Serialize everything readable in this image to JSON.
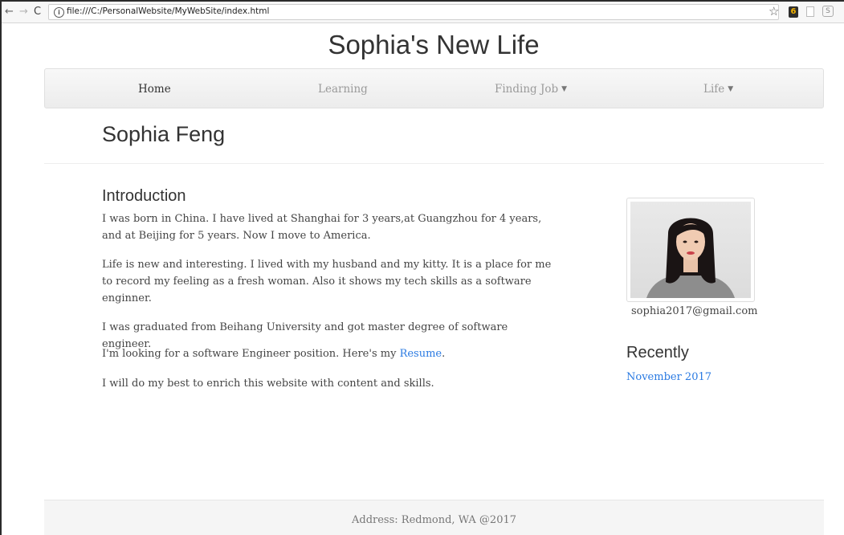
{
  "browser": {
    "back": "←",
    "forward": "→",
    "reload": "C",
    "info": "i",
    "url": "file:///C:/PersonalWebsite/MyWebSite/index.html",
    "star": "☆",
    "ext1": "6",
    "ext3": "S"
  },
  "site": {
    "title": "Sophia's New Life"
  },
  "nav": {
    "items": [
      {
        "label": "Home",
        "active": true
      },
      {
        "label": "Learning"
      },
      {
        "label": "Finding Job",
        "dropdown": true
      },
      {
        "label": "Life",
        "dropdown": true
      }
    ],
    "caret": "▼"
  },
  "profile": {
    "name": "Sophia Feng",
    "email": "sophia2017@gmail.com"
  },
  "intro": {
    "heading": "Introduction",
    "p1": "I was born in China. I have lived at Shanghai for 3 years,at Guangzhou for 4 years, and at Beijing for 5 years. Now I move to America.",
    "p2": "Life is new and interesting. I lived with my husband and my kitty. It is a place for me to record my feeling as a fresh woman. Also it shows my tech skills as a software enginner.",
    "p3": "I was graduated from Beihang University and got master degree of software engineer.",
    "p4_prefix": "I'm looking for a software Engineer position. Here's my ",
    "p4_link": "Resume",
    "p4_suffix": ".",
    "p5": "I will do my best to enrich this website with content and skills."
  },
  "recently": {
    "heading": "Recently",
    "link": "November 2017"
  },
  "footer": {
    "text": "Address: Redmond, WA @2017"
  },
  "colors": {
    "link": "#2a7ae2",
    "navbar_bg": "#f8f8f8",
    "footer_bg": "#f5f5f5"
  }
}
